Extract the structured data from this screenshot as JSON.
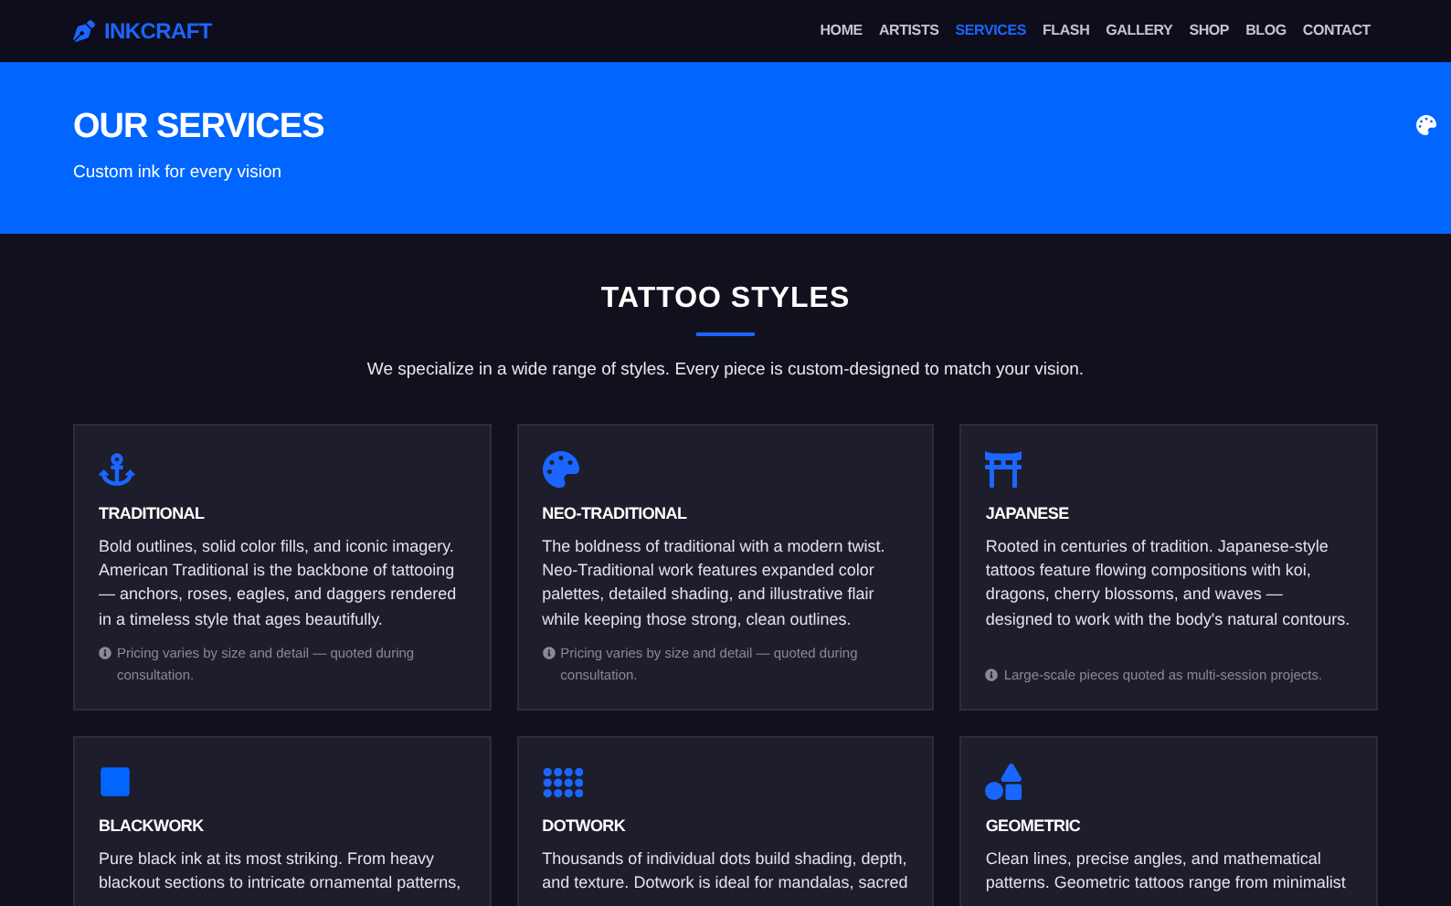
{
  "brand": "INKCRAFT",
  "nav": [
    {
      "label": "HOME",
      "selected": false
    },
    {
      "label": "ARTISTS",
      "selected": false
    },
    {
      "label": "SERVICES",
      "selected": true
    },
    {
      "label": "FLASH",
      "selected": false
    },
    {
      "label": "GALLERY",
      "selected": false
    },
    {
      "label": "SHOP",
      "selected": false
    },
    {
      "label": "BLOG",
      "selected": false
    },
    {
      "label": "CONTACT",
      "selected": false
    }
  ],
  "hero": {
    "title": "OUR SERVICES",
    "subtitle": "Custom ink for every vision"
  },
  "section": {
    "title": "TATTOO STYLES",
    "intro": "We specialize in a wide range of styles. Every piece is custom-designed to match your vision."
  },
  "cards": [
    {
      "title": "TRADITIONAL",
      "description": "Bold outlines, solid color fills, and iconic imagery. American Traditional is the backbone of tattooing — anchors, roses, eagles, and daggers rendered in a timeless style that ages beautifully.",
      "note": "Pricing varies by size and detail — quoted during consultation."
    },
    {
      "title": "NEO-TRADITIONAL",
      "description": "The boldness of traditional with a modern twist. Neo-Traditional work features expanded color palettes, detailed shading, and illustrative flair while keeping those strong, clean outlines.",
      "note": "Pricing varies by size and detail — quoted during consultation."
    },
    {
      "title": "JAPANESE",
      "description": "Rooted in centuries of tradition. Japanese-style tattoos feature flowing compositions with koi, dragons, cherry blossoms, and waves — designed to work with the body's natural contours.",
      "note": "Large-scale pieces quoted as multi-session projects."
    },
    {
      "title": "BLACKWORK",
      "description": "Pure black ink at its most striking. From heavy blackout sections to intricate ornamental patterns,"
    },
    {
      "title": "DOTWORK",
      "description": "Thousands of individual dots build shading, depth, and texture. Dotwork is ideal for mandalas, sacred"
    },
    {
      "title": "GEOMETRIC",
      "description": "Clean lines, precise angles, and mathematical patterns. Geometric tattoos range from minimalist"
    }
  ]
}
